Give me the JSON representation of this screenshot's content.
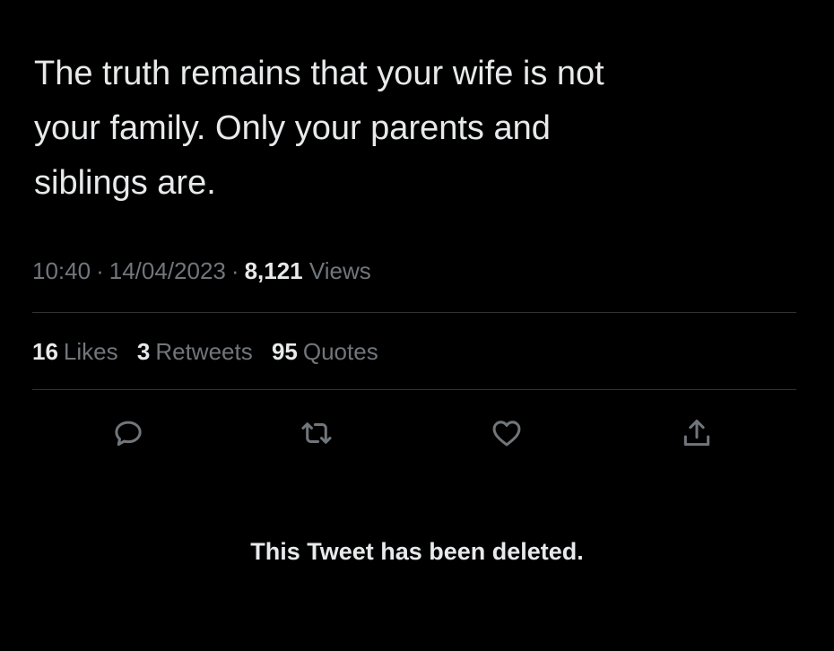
{
  "tweet": {
    "text": "The truth remains that your wife is not\nyour family. Only your parents and\nsiblings are.",
    "time": "10:40",
    "date": "14/04/2023",
    "views_count": "8,121",
    "views_label": "Views",
    "separator": "·"
  },
  "stats": {
    "likes": {
      "count": "16",
      "label": "Likes"
    },
    "retweets": {
      "count": "3",
      "label": "Retweets"
    },
    "quotes": {
      "count": "95",
      "label": "Quotes"
    }
  },
  "actions": [
    {
      "name": "reply",
      "icon": "reply-icon"
    },
    {
      "name": "retweet",
      "icon": "retweet-icon"
    },
    {
      "name": "like",
      "icon": "heart-icon"
    },
    {
      "name": "share",
      "icon": "share-icon"
    }
  ],
  "notice": {
    "deleted_text": "This Tweet has been deleted."
  },
  "colors": {
    "background": "#000000",
    "primary_text": "#e7e9ea",
    "secondary_text": "#71767b",
    "divider": "#2f3336"
  }
}
